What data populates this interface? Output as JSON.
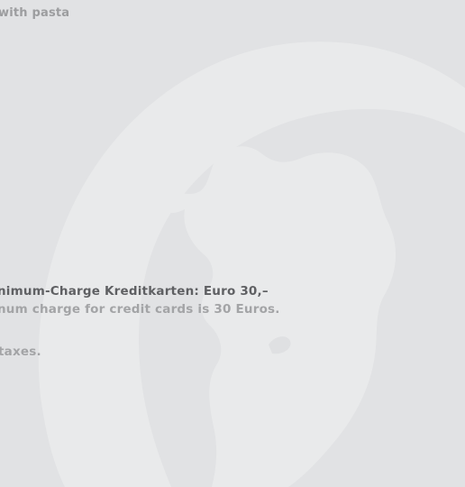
{
  "document": {
    "lines": {
      "pasta": "with pasta",
      "minimum_charge_de": "nimum-Charge Kreditkarten: Euro 30,–",
      "minimum_charge_en": "num charge for credit cards is 30 Euros.",
      "taxes": "taxes."
    },
    "watermark_icon": "rooster-logo-watermark"
  },
  "colors": {
    "background": "#e1e2e4",
    "watermark": "#e9eaeb",
    "text_dark": "#5f6063",
    "text_light": "#a3a4a6"
  }
}
